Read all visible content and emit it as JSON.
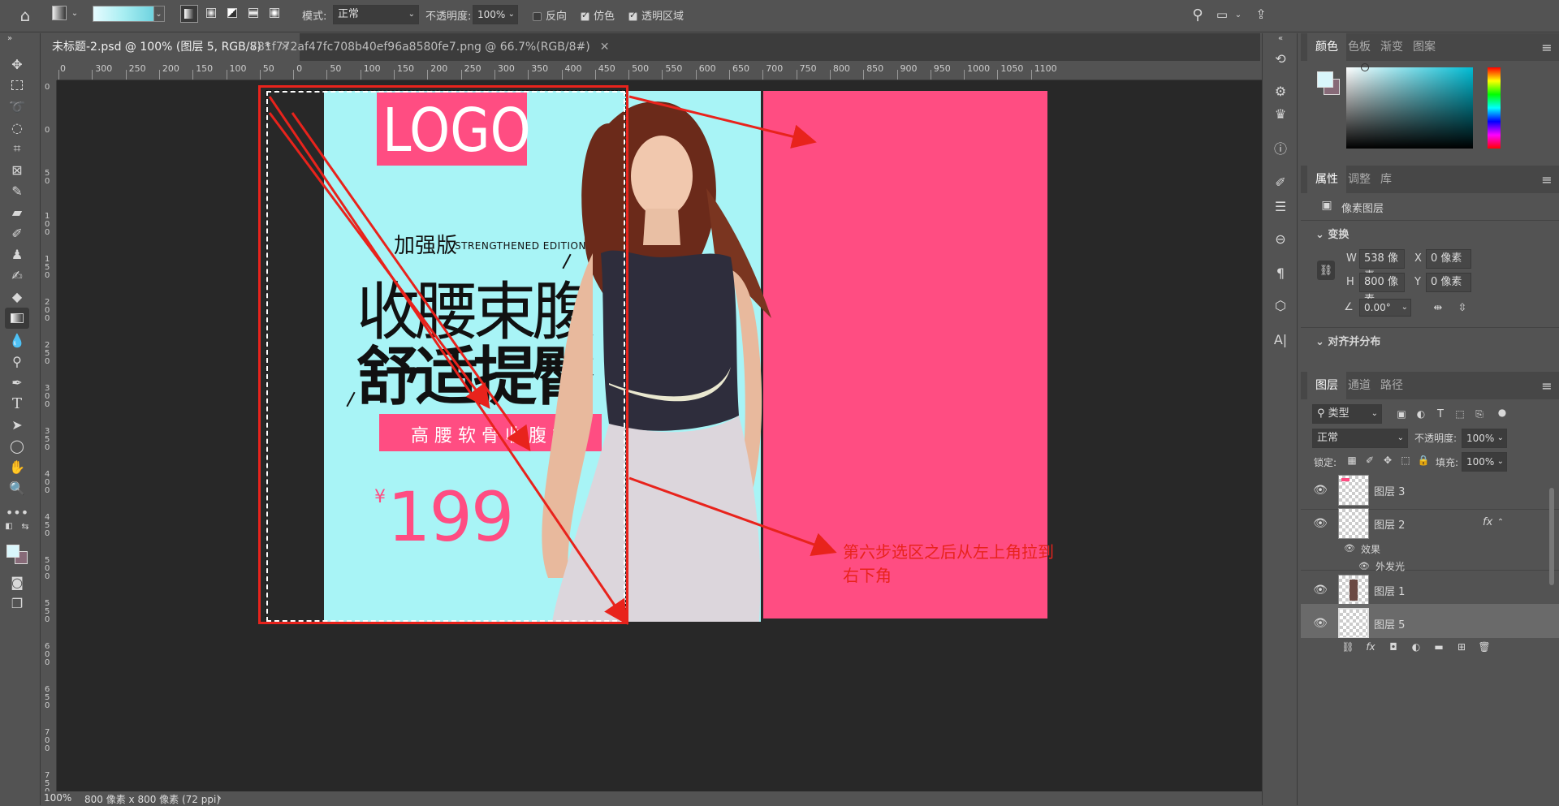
{
  "optbar": {
    "mode_label": "模式:",
    "mode_value": "正常",
    "opacity_label": "不透明度:",
    "opacity_value": "100%",
    "reverse_label": "反向",
    "dither_label": "仿色",
    "transparency_label": "透明区域"
  },
  "tabs": [
    {
      "label": "未标题-2.psd @ 100% (图层 5, RGB/8) *"
    },
    {
      "label": "781f772af47fc708b40ef96a8580fe7.png @ 66.7%(RGB/8#)"
    }
  ],
  "ruler_h": [
    "0",
    "300",
    "250",
    "200",
    "150",
    "100",
    "50",
    "0",
    "50",
    "100",
    "150",
    "200",
    "250",
    "300",
    "350",
    "400",
    "450",
    "500",
    "550",
    "600",
    "650",
    "700",
    "750",
    "800",
    "850",
    "900",
    "950",
    "1000",
    "1050",
    "1100"
  ],
  "ruler_v": [
    "0",
    "0",
    "5 0",
    "1 0 0",
    "1 5 0",
    "2 0 0",
    "2 5 0",
    "3 0 0",
    "3 5 0",
    "4 0 0",
    "4 5 0",
    "5 0 0",
    "5 5 0",
    "6 0 0",
    "6 5 0",
    "7 0 0",
    "7 5 0"
  ],
  "poster": {
    "logo": "LOGO",
    "edition_cn": "加强版",
    "edition_en": "STRENGTHENED EDITION",
    "headline1": "收腰束腹",
    "headline2": "舒适提臀",
    "subtitle": "高 腰 软 骨 收 腹 裤",
    "currency": "¥",
    "price": "199"
  },
  "annotation": {
    "line1": "第六步选区之后从左上角拉到",
    "line2": "右下角"
  },
  "status": {
    "zoom": "100%",
    "info": "800 像素 x 800 像素 (72 ppi)"
  },
  "color_panel": {
    "tabs": [
      "颜色",
      "色板",
      "渐变",
      "图案"
    ]
  },
  "properties": {
    "tabs": [
      "属性",
      "调整",
      "库"
    ],
    "kind": "像素图层",
    "transform_label": "变换",
    "w_label": "W",
    "w_value": "538 像素",
    "x_label": "X",
    "x_value": "0 像素",
    "h_label": "H",
    "h_value": "800 像素",
    "y_label": "Y",
    "y_value": "0 像素",
    "angle_value": "0.00°",
    "align_label": "对齐并分布"
  },
  "layers_panel": {
    "tabs": [
      "图层",
      "通道",
      "路径"
    ],
    "filter_value": "类型",
    "blend_value": "正常",
    "opacity_label": "不透明度:",
    "opacity_value": "100%",
    "lock_label": "锁定:",
    "fill_label": "填充:",
    "fill_value": "100%",
    "fx": "fx",
    "effects_label": "效果",
    "outer_glow_label": "外发光",
    "layers": [
      {
        "name": "图层 3"
      },
      {
        "name": "图层 2"
      },
      {
        "name": "图层 1"
      },
      {
        "name": "图层 5"
      }
    ]
  },
  "colors": {
    "poster_bg": "#a8f4f6",
    "pink": "#ff4d82",
    "red_arrow": "#e8231c",
    "workspace": "#282828",
    "foreground": "#d9f6fb",
    "background": "#876a78"
  }
}
